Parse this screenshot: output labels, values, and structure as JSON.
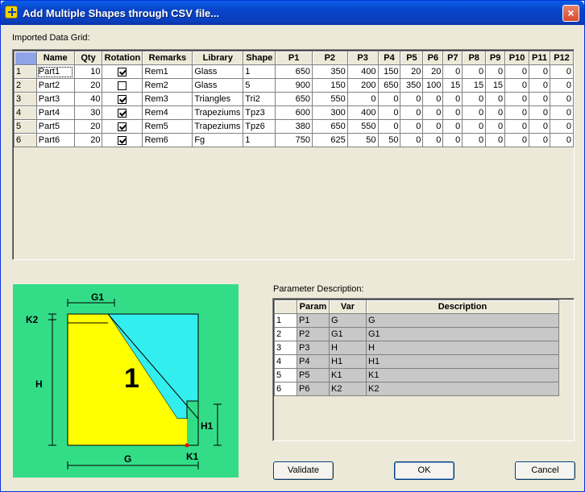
{
  "window": {
    "title": "Add Multiple Shapes through CSV file...",
    "close": "×"
  },
  "imported": {
    "label": "Imported Data Grid:",
    "columns": [
      "Name",
      "Qty",
      "Rotation",
      "Remarks",
      "Library",
      "Shape",
      "P1",
      "P2",
      "P3",
      "P4",
      "P5",
      "P6",
      "P7",
      "P8",
      "P9",
      "P10",
      "P11",
      "P12"
    ],
    "rows": [
      {
        "n": "1",
        "name": "Part1",
        "qty": "10",
        "rot": true,
        "remarks": "Rem1",
        "library": "Glass",
        "shape": "1",
        "p": [
          "650",
          "350",
          "400",
          "150",
          "20",
          "20",
          "0",
          "0",
          "0",
          "0",
          "0",
          "0"
        ]
      },
      {
        "n": "2",
        "name": "Part2",
        "qty": "20",
        "rot": false,
        "remarks": "Rem2",
        "library": "Glass",
        "shape": "5",
        "p": [
          "900",
          "150",
          "200",
          "650",
          "350",
          "100",
          "15",
          "15",
          "15",
          "0",
          "0",
          "0"
        ]
      },
      {
        "n": "3",
        "name": "Part3",
        "qty": "40",
        "rot": true,
        "remarks": "Rem3",
        "library": "Triangles",
        "shape": "Tri2",
        "p": [
          "650",
          "550",
          "0",
          "0",
          "0",
          "0",
          "0",
          "0",
          "0",
          "0",
          "0",
          "0"
        ]
      },
      {
        "n": "4",
        "name": "Part4",
        "qty": "30",
        "rot": true,
        "remarks": "Rem4",
        "library": "Trapeziums",
        "shape": "Tpz3",
        "p": [
          "600",
          "300",
          "400",
          "0",
          "0",
          "0",
          "0",
          "0",
          "0",
          "0",
          "0",
          "0"
        ]
      },
      {
        "n": "5",
        "name": "Part5",
        "qty": "20",
        "rot": true,
        "remarks": "Rem5",
        "library": "Trapeziums",
        "shape": "Tpz6",
        "p": [
          "380",
          "650",
          "550",
          "0",
          "0",
          "0",
          "0",
          "0",
          "0",
          "0",
          "0",
          "0"
        ]
      },
      {
        "n": "6",
        "name": "Part6",
        "qty": "20",
        "rot": true,
        "remarks": "Rem6",
        "library": "Fg",
        "shape": "1",
        "p": [
          "750",
          "625",
          "50",
          "50",
          "0",
          "0",
          "0",
          "0",
          "0",
          "0",
          "0",
          "0"
        ]
      }
    ]
  },
  "diagram": {
    "labels": {
      "g1": "G1",
      "k2": "K2",
      "h": "H",
      "h1": "H1",
      "g": "G",
      "k1": "K1",
      "shape_number": "1"
    },
    "colors": {
      "background": "#33dd88",
      "body": "#ffff00",
      "cut": "#33eeee"
    }
  },
  "params": {
    "label": "Parameter Description:",
    "columns": [
      "Param",
      "Var",
      "Description"
    ],
    "rows": [
      {
        "n": "1",
        "param": "P1",
        "var": "G",
        "desc": "G"
      },
      {
        "n": "2",
        "param": "P2",
        "var": "G1",
        "desc": "G1"
      },
      {
        "n": "3",
        "param": "P3",
        "var": "H",
        "desc": "H"
      },
      {
        "n": "4",
        "param": "P4",
        "var": "H1",
        "desc": "H1"
      },
      {
        "n": "5",
        "param": "P5",
        "var": "K1",
        "desc": "K1"
      },
      {
        "n": "6",
        "param": "P6",
        "var": "K2",
        "desc": "K2"
      }
    ]
  },
  "buttons": {
    "validate": "Validate",
    "ok": "OK",
    "cancel": "Cancel"
  }
}
